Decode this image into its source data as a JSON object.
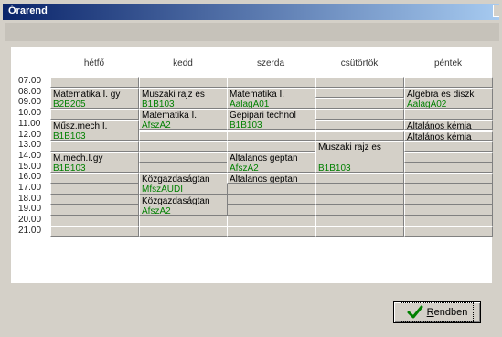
{
  "window": {
    "title": "Órarend"
  },
  "days": [
    "hétfő",
    "kedd",
    "szerda",
    "csütörtök",
    "péntek"
  ],
  "times": [
    "07.00",
    "08.00",
    "09.00",
    "10.00",
    "11.00",
    "12.00",
    "13.00",
    "14.00",
    "15.00",
    "16.00",
    "17.00",
    "18.00",
    "19.00",
    "20.00",
    "21.00"
  ],
  "lessons": [
    {
      "day": 0,
      "start": 1,
      "span": 2,
      "subject": "Matematika I. gy",
      "room": "B2B205"
    },
    {
      "day": 0,
      "start": 4,
      "span": 2,
      "subject": "Műsz.mech.I.",
      "room": "B1B103"
    },
    {
      "day": 0,
      "start": 7,
      "span": 2,
      "subject": "M.mech.I.gy",
      "room": "B1B103"
    },
    {
      "day": 1,
      "start": 1,
      "span": 2,
      "subject": "Muszaki rajz es",
      "room": "B1B103"
    },
    {
      "day": 1,
      "start": 3,
      "span": 2,
      "subject": "Matematika I.",
      "room": "AfszA2"
    },
    {
      "day": 1,
      "start": 9,
      "span": 2,
      "subject": "Közgazdaságtan",
      "room": "MfszAUDI"
    },
    {
      "day": 1,
      "start": 11,
      "span": 2,
      "subject": "Közgazdaságtan",
      "room": "AfszA2"
    },
    {
      "day": 2,
      "start": 1,
      "span": 2,
      "subject": "Matematika I.",
      "room": "AalagA01"
    },
    {
      "day": 2,
      "start": 3,
      "span": 2,
      "subject": "Gepipari technol",
      "room": "B1B103"
    },
    {
      "day": 2,
      "start": 7,
      "span": 2,
      "subject": "Altalanos geptan",
      "room": "AfszA2"
    },
    {
      "day": 2,
      "start": 9,
      "span": 1,
      "subject": "Altalanos geptan",
      "room": ""
    },
    {
      "day": 3,
      "start": 6,
      "span": 3,
      "subject": "Muszaki rajz es",
      "room": "B1B103"
    },
    {
      "day": 4,
      "start": 1,
      "span": 2,
      "subject": "Algebra es diszk",
      "room": "AalagA02"
    },
    {
      "day": 4,
      "start": 4,
      "span": 1,
      "subject": "Általános kémia",
      "room": ""
    },
    {
      "day": 4,
      "start": 5,
      "span": 1,
      "subject": "Általános kémia",
      "room": ""
    }
  ],
  "ok_button": {
    "label": "Rendben",
    "accel": "R",
    "rest": "endben",
    "icon": "check-icon"
  },
  "colors": {
    "room_text": "#008000",
    "title_bar": "#0a246a"
  }
}
